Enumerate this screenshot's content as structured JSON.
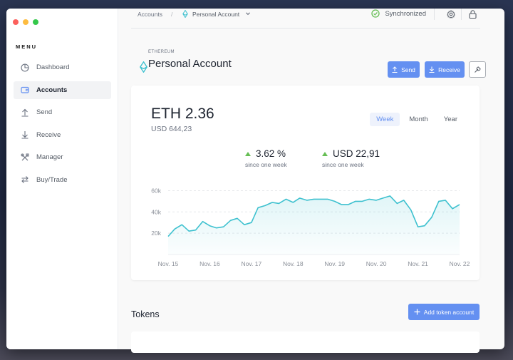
{
  "window": {
    "traffic_colors": [
      "#fc605c",
      "#fdbc40",
      "#34c84a"
    ]
  },
  "sidebar": {
    "menu_title": "MENU",
    "items": [
      {
        "label": "Dashboard",
        "icon": "pie-chart-icon",
        "active": false
      },
      {
        "label": "Accounts",
        "icon": "wallet-icon",
        "active": true
      },
      {
        "label": "Send",
        "icon": "arrow-up-icon",
        "active": false
      },
      {
        "label": "Receive",
        "icon": "arrow-down-icon",
        "active": false
      },
      {
        "label": "Manager",
        "icon": "tools-icon",
        "active": false
      },
      {
        "label": "Buy/Trade",
        "icon": "swap-icon",
        "active": false
      }
    ]
  },
  "topbar": {
    "breadcrumb_root": "Accounts",
    "breadcrumb_sep": "/",
    "breadcrumb_current": "Personal Account",
    "sync_status": "Synchronized",
    "status_color": "#66be54"
  },
  "account": {
    "currency_label": "ETHEREUM",
    "name": "Personal Account",
    "send_label": "Send",
    "receive_label": "Receive",
    "accent_color": "#6490f1",
    "eth_color": "#3ec1cf"
  },
  "balance": {
    "crypto": "ETH 2.36",
    "fiat": "USD 644,23",
    "ranges": [
      "Week",
      "Month",
      "Year"
    ],
    "selected_range": "Week",
    "changes": [
      {
        "value": "3.62 %",
        "label": "since one week"
      },
      {
        "value": "USD 22,91",
        "label": "since one week"
      }
    ]
  },
  "chart_data": {
    "type": "area",
    "title": "",
    "xlabel": "",
    "ylabel": "",
    "ylim": [
      0,
      65000
    ],
    "grid": true,
    "y_ticks": [
      "60k",
      "40k",
      "20k"
    ],
    "y_tick_values": [
      60000,
      40000,
      20000
    ],
    "categories": [
      "Nov. 15",
      "Nov. 16",
      "Nov. 17",
      "Nov. 18",
      "Nov. 19",
      "Nov. 20",
      "Nov. 21",
      "Nov. 22"
    ],
    "x": [
      0,
      0.16,
      0.33,
      0.5,
      0.66,
      0.83,
      1,
      1.16,
      1.33,
      1.5,
      1.66,
      1.83,
      2,
      2.16,
      2.33,
      2.5,
      2.66,
      2.83,
      3,
      3.16,
      3.33,
      3.5,
      3.66,
      3.83,
      4,
      4.16,
      4.33,
      4.5,
      4.66,
      4.83,
      5,
      5.16,
      5.33,
      5.5,
      5.66,
      5.83,
      6,
      6.16,
      6.33,
      6.5,
      6.66,
      6.83,
      7
    ],
    "series": [
      {
        "color": "#3ec1cf",
        "values": [
          17000,
          24000,
          28000,
          22000,
          23000,
          31000,
          27000,
          25000,
          26000,
          32000,
          34000,
          28000,
          30000,
          44000,
          46000,
          49000,
          48000,
          52000,
          49000,
          53000,
          51000,
          52000,
          52000,
          52000,
          50000,
          47000,
          47000,
          50000,
          50000,
          52000,
          51000,
          53000,
          55000,
          48000,
          51000,
          42000,
          26000,
          27000,
          35000,
          50000,
          51000,
          43000,
          47000
        ]
      }
    ]
  },
  "tokens": {
    "title": "Tokens",
    "add_label": "Add token account"
  }
}
